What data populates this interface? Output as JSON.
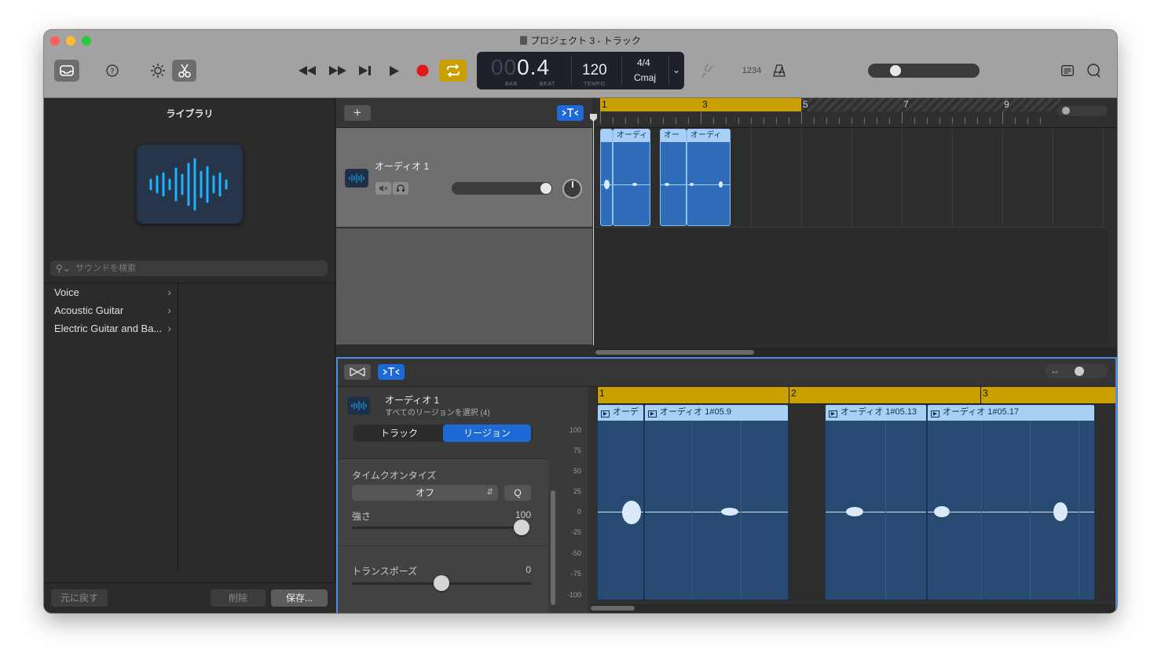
{
  "window": {
    "title": "プロジェクト 3 - トラック"
  },
  "toolbar": {
    "lcd": {
      "bar_dim": "00",
      "position": "0.4",
      "bar_label": "BAR",
      "beat_label": "BEAT",
      "tempo": "120",
      "tempo_label": "TEMPO",
      "signature": "4/4",
      "key": "Cmaj"
    },
    "count_in_label": "1234",
    "master_volume": 0.22
  },
  "library": {
    "title": "ライブラリ",
    "search_placeholder": "サウンドを検索",
    "items": [
      {
        "label": "Voice"
      },
      {
        "label": "Acoustic Guitar"
      },
      {
        "label": "Electric Guitar and Ba..."
      }
    ],
    "buttons": {
      "revert": "元に戻す",
      "delete": "削除",
      "save": "保存..."
    }
  },
  "tracks": {
    "ruler_bars": [
      "1",
      "3",
      "5",
      "7",
      "9"
    ],
    "track": {
      "name": "オーディオ 1",
      "volume": 1.0
    },
    "regions": [
      {
        "label": ""
      },
      {
        "label": "オーディ"
      },
      {
        "label": "オー"
      },
      {
        "label": "オーディ"
      }
    ]
  },
  "editor": {
    "track_name": "オーディオ 1",
    "selection_info": "すべてのリージョンを選択 (4)",
    "tabs": [
      "トラック",
      "リージョン"
    ],
    "active_tab": "リージョン",
    "time_quantize_label": "タイムクオンタイズ",
    "time_quantize_value": "オフ",
    "q_button": "Q",
    "strength_label": "強さ",
    "strength_value": "100",
    "strength_level": 1.0,
    "transpose_label": "トランスポーズ",
    "transpose_value": "0",
    "transpose_level": 0.5,
    "ruler_bars": [
      "1",
      "2",
      "3"
    ],
    "db_labels": [
      "100",
      "75",
      "50",
      "25",
      "0",
      "-25",
      "-50",
      "-75",
      "-100"
    ],
    "regions": [
      {
        "label": "オーデ"
      },
      {
        "label": "オーディオ 1#05.9"
      },
      {
        "label": "オーディオ 1#05.13"
      },
      {
        "label": "オーディオ 1#05.17"
      }
    ]
  }
}
